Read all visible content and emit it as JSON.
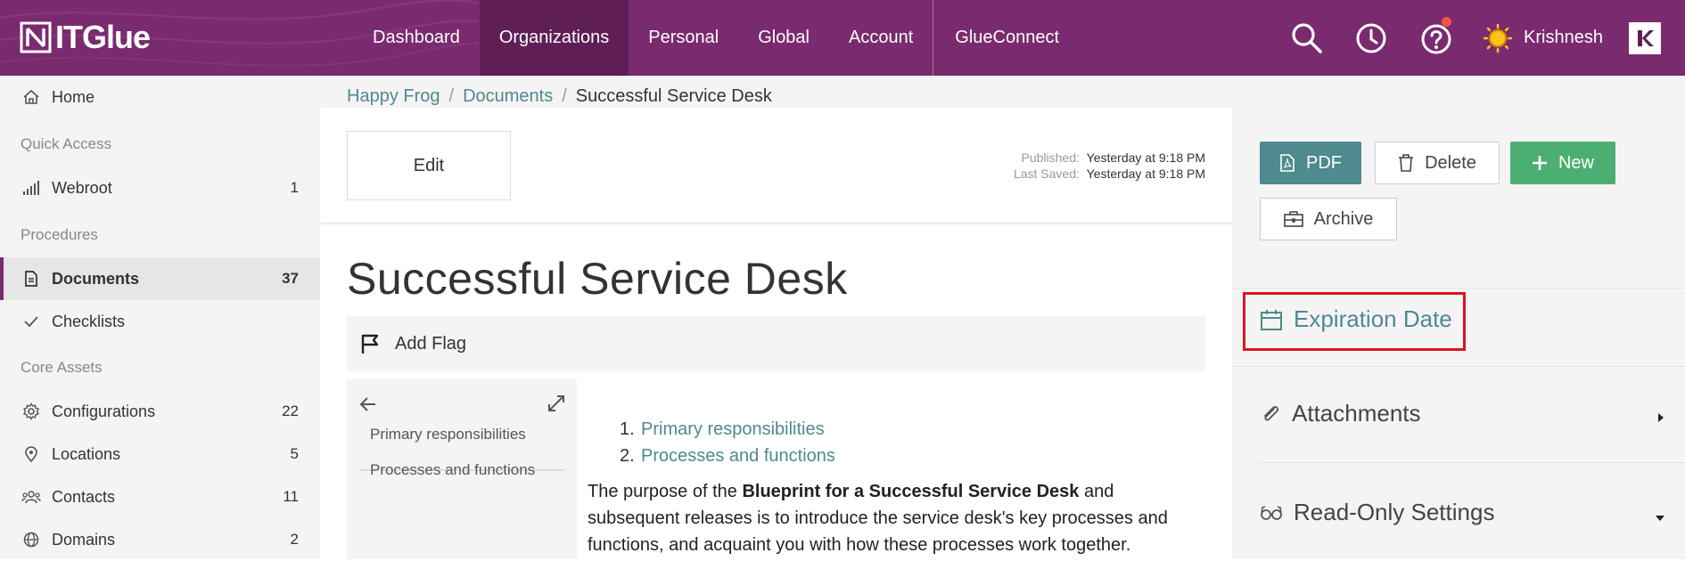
{
  "brand": {
    "name": "ITGlue"
  },
  "nav": {
    "items": [
      "Dashboard",
      "Organizations",
      "Personal",
      "Global",
      "Account",
      "GlueConnect"
    ],
    "active": "Organizations"
  },
  "user": {
    "name": "Krishnesh"
  },
  "sidebar": {
    "home": "Home",
    "sections": [
      {
        "title": "Quick Access",
        "items": [
          {
            "label": "Webroot",
            "count": "1"
          }
        ]
      },
      {
        "title": "Procedures",
        "items": [
          {
            "label": "Documents",
            "count": "37"
          },
          {
            "label": "Checklists",
            "count": ""
          }
        ]
      },
      {
        "title": "Core Assets",
        "items": [
          {
            "label": "Configurations",
            "count": "22"
          },
          {
            "label": "Locations",
            "count": "5"
          },
          {
            "label": "Contacts",
            "count": "11"
          },
          {
            "label": "Domains",
            "count": "2"
          }
        ]
      }
    ]
  },
  "breadcrumb": {
    "org": "Happy Frog",
    "section": "Documents",
    "current": "Successful Service Desk"
  },
  "document": {
    "edit_label": "Edit",
    "published_key": "Published:",
    "published_val": "Yesterday at 9:18 PM",
    "saved_key": "Last Saved:",
    "saved_val": "Yesterday at 9:18 PM",
    "title": "Successful Service Desk",
    "add_flag": "Add Flag",
    "toc": [
      "Primary responsibilities",
      "Processes and functions"
    ],
    "list": [
      "Primary responsibilities",
      "Processes and functions"
    ],
    "para_prefix": "The purpose of the ",
    "para_bold": "Blueprint for a Successful Service Desk",
    "para_rest": "  and subsequent releases is to introduce the service desk's key processes and functions, and acquaint you with how these processes work together."
  },
  "actions": {
    "pdf": "PDF",
    "delete": "Delete",
    "new": "New",
    "archive": "Archive"
  },
  "panel": {
    "expiration": "Expiration Date",
    "attachments": "Attachments",
    "readonly": "Read-Only Settings"
  },
  "colors": {
    "brand": "#7a2a6e",
    "teal": "#4e8a8e",
    "green": "#4caf72",
    "highlight": "#e0131f"
  }
}
